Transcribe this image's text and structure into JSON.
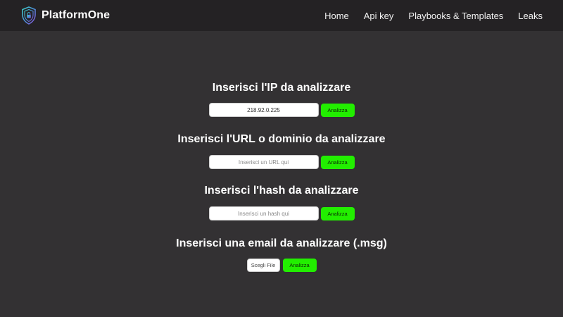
{
  "app": {
    "name": "PlatformOne",
    "logo_icon": "shield-lock-icon",
    "accent_color": "#22ee00"
  },
  "nav": {
    "items": [
      {
        "label": "Home"
      },
      {
        "label": "Api key"
      },
      {
        "label": "Playbooks & Templates"
      },
      {
        "label": "Leaks"
      }
    ]
  },
  "sections": {
    "ip": {
      "title": "Inserisci l'IP da analizzare",
      "value": "218.92.0.225",
      "placeholder": "",
      "button_label": "Analizza"
    },
    "url": {
      "title": "Inserisci l'URL o dominio da analizzare",
      "value": "",
      "placeholder": "Inserisci un URL qui",
      "button_label": "Analizza"
    },
    "hash": {
      "title": "Inserisci l'hash da analizzare",
      "value": "",
      "placeholder": "Inserisci un hash qui",
      "button_label": "Analizza"
    },
    "email": {
      "title": "Inserisci una email da analizzare (.msg)",
      "file_button_label": "Scegli File",
      "button_label": "Analizza"
    }
  }
}
